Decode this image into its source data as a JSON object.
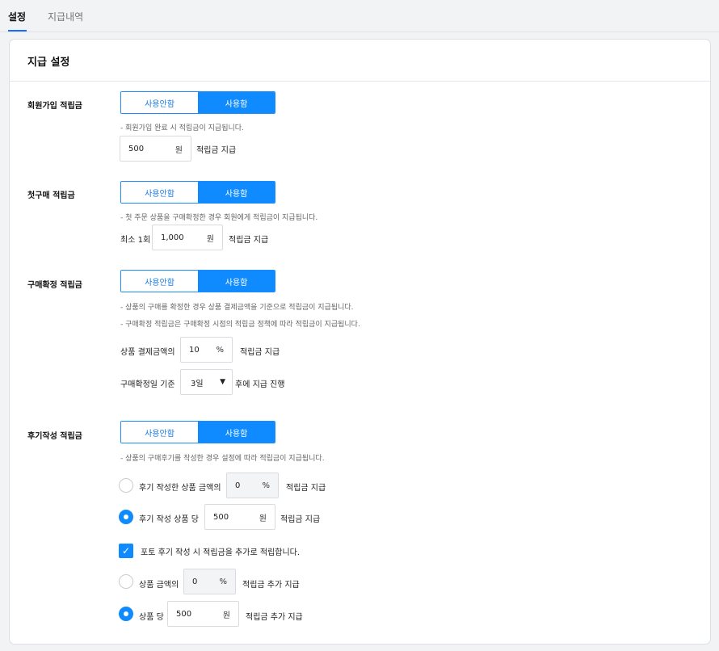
{
  "tabs": [
    {
      "label": "설정",
      "active": true
    },
    {
      "label": "지급내역",
      "active": false
    }
  ],
  "card": {
    "title": "지급 설정"
  },
  "toggle": {
    "off_label": "사용안함",
    "on_label": "사용함",
    "selected": "사용함"
  },
  "signup": {
    "label": "회원가입 적립금",
    "note": "-  회원가입 완료 시 적립금이 지급됩니다.",
    "amount": "500",
    "unit": "원",
    "suffix": "적립금 지급"
  },
  "first_purchase": {
    "label": "첫구매 적립금",
    "note": "-  첫 주문 상품을 구매확정한 경우 회원에게 적립금이 지급됩니다.",
    "prefix": "최소 1회",
    "amount": "1,000",
    "unit": "원",
    "suffix": "적립금 지급"
  },
  "confirm": {
    "label": "구매확정 적립금",
    "notes": [
      "-  상품의 구매를 확정한 경우 상품 결제금액을 기준으로 적립금이 지급됩니다.",
      "-  구매확정 적립금은 구매확정 시점의 적립금 정책에 따라 적립금이 지급됩니다."
    ],
    "rate_prefix": "상품 결제금액의",
    "rate": "10",
    "rate_unit": "%",
    "rate_suffix": "적립금 지급",
    "day_prefix": "구매확정일 기준",
    "day_value": "3일",
    "day_suffix": "후에 지급 진행"
  },
  "review": {
    "label": "후기작성 적립금",
    "note": "-  상품의 구매후기를 작성한 경우 설정에 따라 적립금이 지급됩니다.",
    "option1": {
      "label": "후기 작성한 상품 금액의",
      "value": "0",
      "unit": "%",
      "suffix": "적립금 지급",
      "checked": false
    },
    "option2": {
      "label": "후기 작성 상품 당",
      "value": "500",
      "unit": "원",
      "suffix": "적립금 지급",
      "checked": true
    },
    "photo_checkbox": {
      "label": "포토 후기 작성 시 적립금을 추가로 적립합니다.",
      "checked": true
    },
    "photo_option1": {
      "label": "상품 금액의",
      "value": "0",
      "unit": "%",
      "suffix": "적립금 추가 지급",
      "checked": false
    },
    "photo_option2": {
      "label": "상품 당",
      "value": "500",
      "unit": "원",
      "suffix": "적립금 추가 지급",
      "checked": true
    }
  },
  "colors": {
    "accent": "#0f8bff",
    "tab_indicator": "#1a6dff"
  }
}
